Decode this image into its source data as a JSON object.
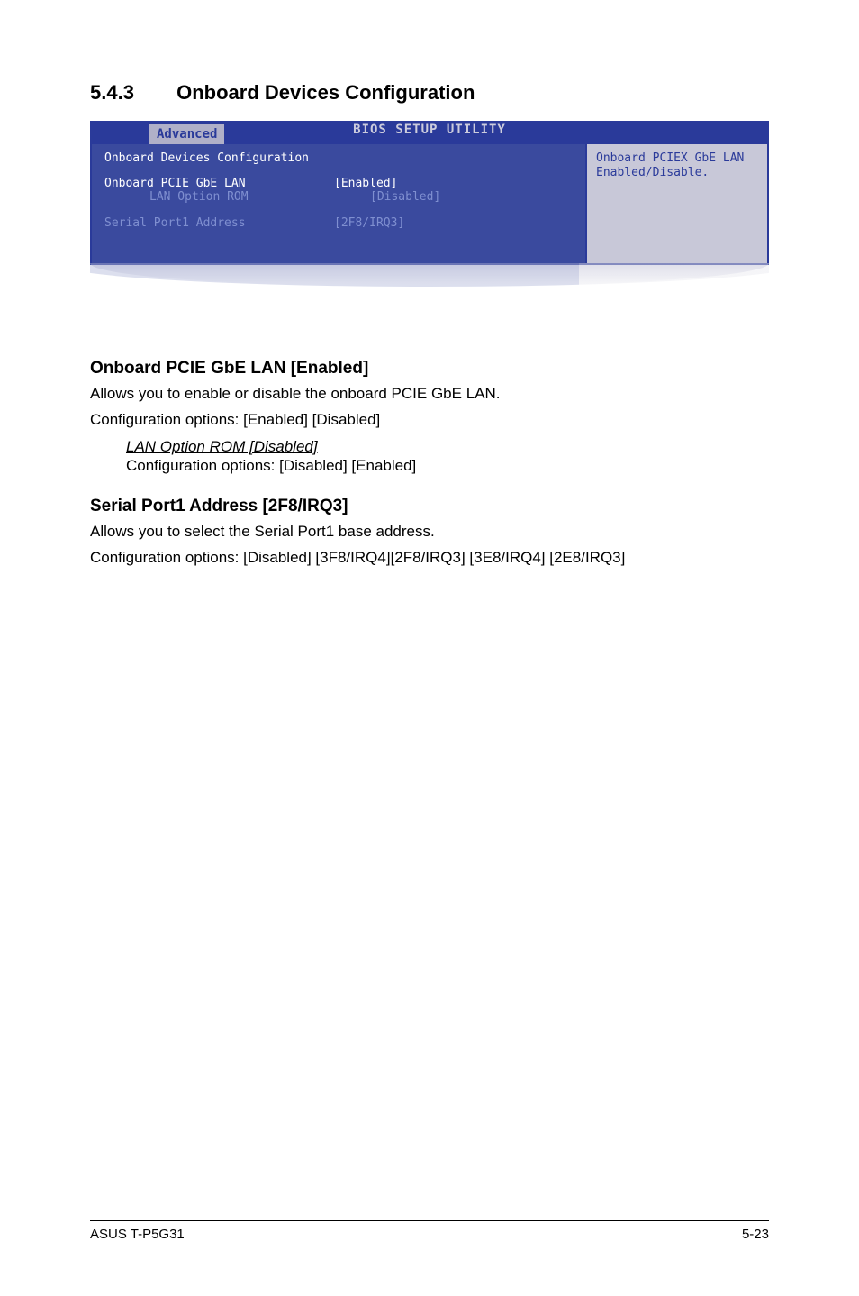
{
  "heading": {
    "number": "5.4.3",
    "title": "Onboard Devices Configuration"
  },
  "bios": {
    "title": "BIOS SETUP UTILITY",
    "tab": "Advanced",
    "panel_title": "Onboard Devices Configuration",
    "rows": [
      {
        "label": "Onboard PCIE GbE LAN",
        "value": "[Enabled]",
        "selected": true,
        "indent": false
      },
      {
        "label": "LAN Option ROM",
        "value": "[Disabled]",
        "selected": false,
        "indent": true
      },
      {
        "label": "",
        "value": "",
        "spacer": true
      },
      {
        "label": "Serial Port1 Address",
        "value": "[2F8/IRQ3]",
        "selected": false,
        "indent": false
      }
    ],
    "help": "Onboard PCIEX GbE LAN Enabled/Disable."
  },
  "sections": [
    {
      "heading": "Onboard PCIE GbE LAN [Enabled]",
      "paragraphs": [
        "Allows you to enable or disable the onboard PCIE GbE LAN.",
        "Configuration options: [Enabled] [Disabled]"
      ],
      "sub": {
        "title": "LAN Option ROM [Disabled]",
        "line": "Configuration options: [Disabled] [Enabled]"
      }
    },
    {
      "heading": "Serial Port1 Address [2F8/IRQ3]",
      "paragraphs": [
        "Allows you to select the Serial Port1 base address.",
        "Configuration options: [Disabled] [3F8/IRQ4][2F8/IRQ3] [3E8/IRQ4] [2E8/IRQ3]"
      ]
    }
  ],
  "footer": {
    "left": "ASUS T-P5G31",
    "right": "5-23"
  }
}
